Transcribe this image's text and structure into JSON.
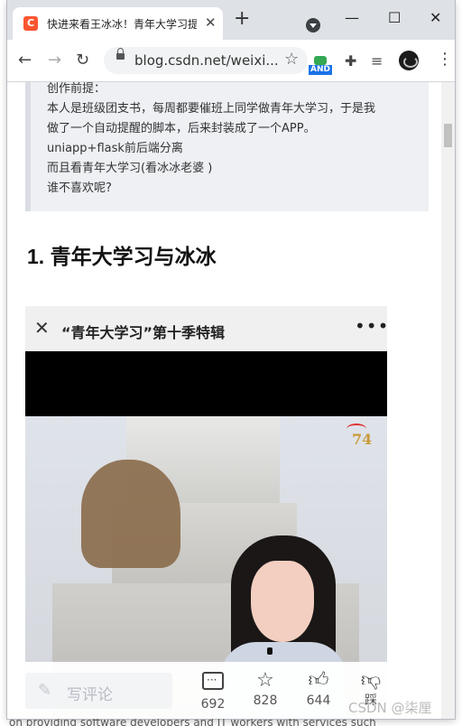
{
  "browser": {
    "tab_title": "快进来看王冰冰！青年大学习提",
    "favicon_letter": "C",
    "url": "blog.csdn.net/weixi...",
    "extension_badge": "AND"
  },
  "article": {
    "quote_lines": [
      "创作前提：",
      "本人是班级团支书，每周都要催班上同学做青年大学习，于是我",
      "做了一个自动提醒的脚本，后来封装成了一个APP。",
      "uniapp+flask前后端分离",
      "而且看青年大学习(看冰冰老婆 )",
      "谁不喜欢呢?"
    ],
    "heading": "1. 青年大学习与冰冰",
    "media_title": "“青年大学习”第十季特辑",
    "video_logo": "74"
  },
  "action_bar": {
    "comment_placeholder": "写评论",
    "comments": "692",
    "favorites": "828",
    "likes": "644",
    "dislike_label": "踩"
  },
  "watermark": "CSDN @柒厘",
  "behind_text": "on providing software developers and IT workers with services such"
}
